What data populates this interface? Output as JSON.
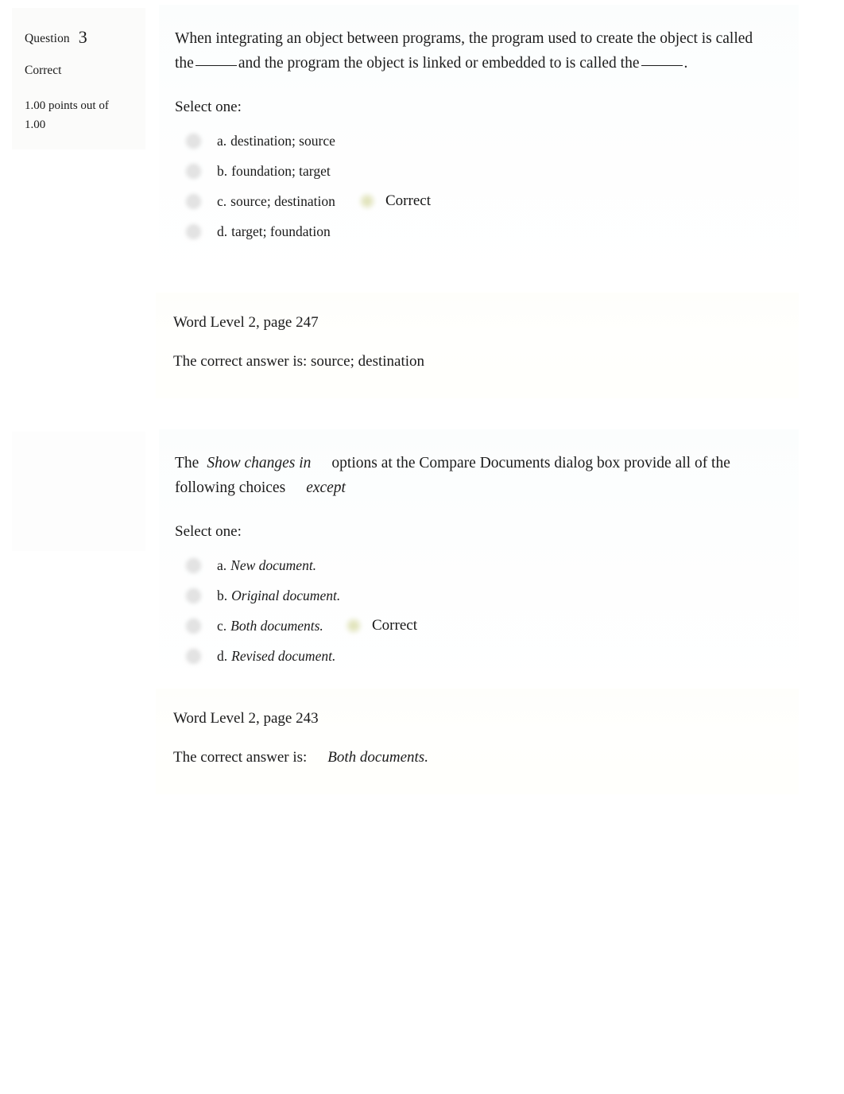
{
  "page": {
    "accent_correct": "#dcdfae",
    "panel_bg": "#fbfdfd",
    "feedback_bg": "#fefefb"
  },
  "questions": [
    {
      "info": {
        "question_label": "Question",
        "question_number": "3",
        "state": "Correct",
        "grade": "1.00 points out of 1.00"
      },
      "stem": {
        "part1": "When integrating an object between programs, the program used to create the object is called the",
        "part2": "and the program the object is linked or embedded to is called the",
        "part3": "."
      },
      "select_one": "Select one:",
      "options": [
        {
          "letter": "a.",
          "text": "destination; source",
          "italic": false,
          "correct": false
        },
        {
          "letter": "b.",
          "text": "foundation; target",
          "italic": false,
          "correct": false
        },
        {
          "letter": "c.",
          "text": "source; destination",
          "italic": false,
          "correct": true,
          "correct_label": "Correct"
        },
        {
          "letter": "d.",
          "text": "target; foundation",
          "italic": false,
          "correct": false
        }
      ],
      "feedback": {
        "reference": "Word Level 2, page 247",
        "answer_prefix": "The correct answer is: source; destination",
        "answer_italic": ""
      }
    },
    {
      "info": {
        "question_label": "",
        "question_number": "",
        "state": "",
        "grade": ""
      },
      "stem_rich": {
        "lead": "The",
        "italic1": "Show changes in",
        "mid": "options at the Compare Documents dialog box provide all of the following choices",
        "italic2": "except"
      },
      "select_one": "Select one:",
      "options": [
        {
          "letter": "a.",
          "text": "New document.",
          "italic": true,
          "correct": false
        },
        {
          "letter": "b.",
          "text": "Original document.",
          "italic": true,
          "correct": false
        },
        {
          "letter": "c.",
          "text": "Both documents.",
          "italic": true,
          "correct": true,
          "correct_label": "Correct"
        },
        {
          "letter": "d.",
          "text": "Revised document.",
          "italic": true,
          "correct": false
        }
      ],
      "feedback": {
        "reference": "Word Level 2, page 243",
        "answer_prefix": "The correct answer is:",
        "answer_italic": "Both documents."
      }
    }
  ]
}
